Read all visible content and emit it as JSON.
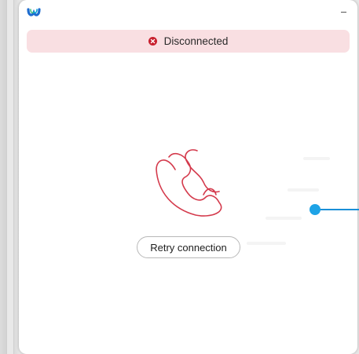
{
  "window": {
    "logo_icon": "webex-logo-icon",
    "minimize_icon": "minimize-icon"
  },
  "status": {
    "text": "Disconnected",
    "icon": "error-x-circle-icon",
    "background_color": "#f9dfe2",
    "icon_color": "#c8202e"
  },
  "illustration": {
    "icon": "phone-handset-icon",
    "stroke_color": "#d43a4c"
  },
  "actions": {
    "retry_label": "Retry connection"
  },
  "annotation": {
    "marker_color": "#1ea3e6"
  }
}
